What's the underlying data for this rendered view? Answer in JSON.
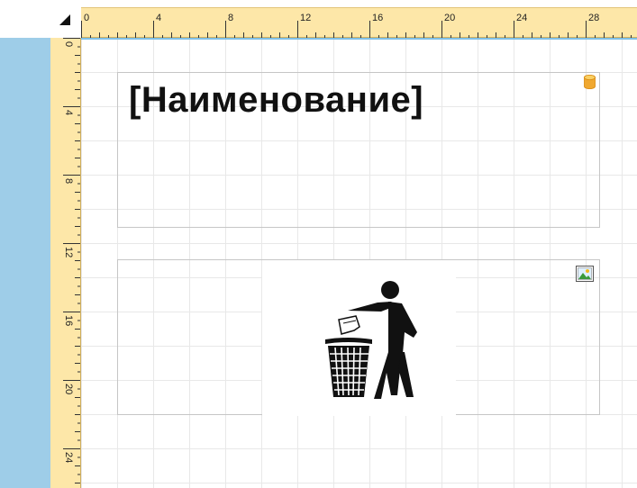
{
  "ruler": {
    "h_labels": [
      "0",
      "4",
      "8",
      "12",
      "16",
      "20",
      "24",
      "28"
    ],
    "v_labels": [
      "0",
      "4",
      "8",
      "12",
      "16",
      "20",
      "24"
    ]
  },
  "bands": {
    "text_band": {
      "text": "[Наименование]",
      "icon": "database-icon"
    },
    "image_band": {
      "icon": "image-icon",
      "picture": "litter-bin-person-icon"
    }
  },
  "colors": {
    "ruler_bg": "#fde7a8",
    "left_strip": "#9ecde8",
    "db_icon": "#f0a830"
  }
}
